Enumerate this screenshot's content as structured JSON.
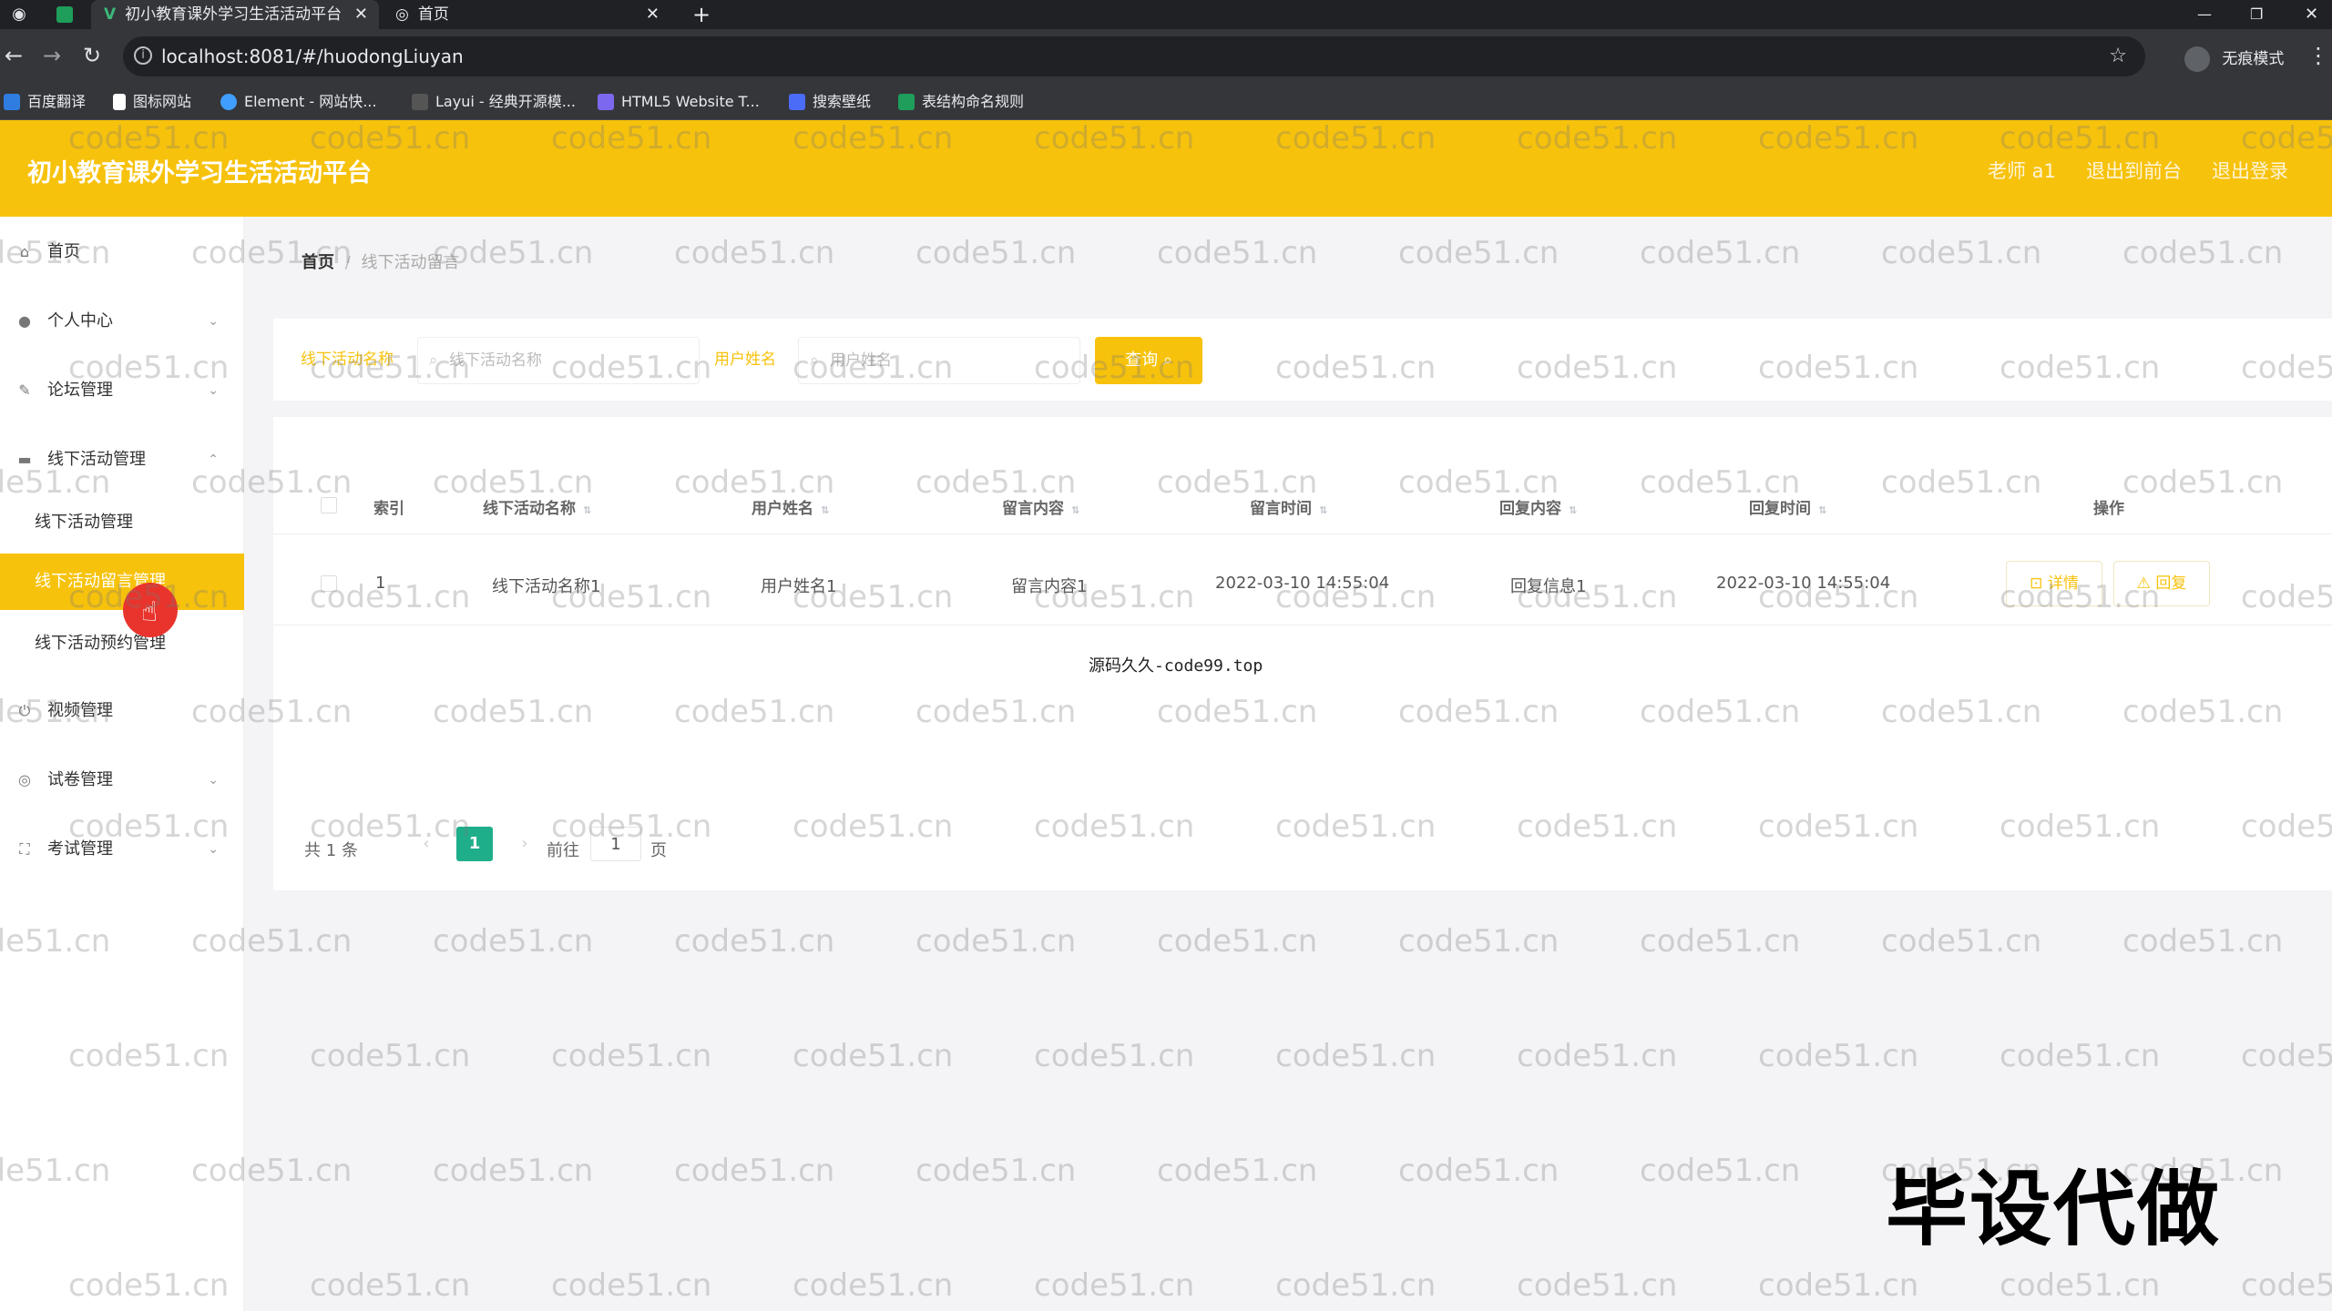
{
  "browser": {
    "tabs": [
      {
        "title": "初小教育课外学习生活活动平台",
        "active": true
      },
      {
        "title": "首页",
        "active": false
      }
    ],
    "new_tab": "+",
    "url": "localhost:8081/#/huodongLiuyan",
    "profile_label": "无痕模式",
    "bookmarks": [
      "百度翻译",
      "图标网站",
      "Element - 网站快...",
      "Layui - 经典开源模...",
      "HTML5 Website T...",
      "搜索壁纸",
      "表结构命名规则"
    ]
  },
  "header": {
    "title": "初小教育课外学习生活活动平台",
    "user": "老师 a1",
    "back_front": "退出到前台",
    "logout": "退出登录"
  },
  "sidebar": {
    "items": [
      {
        "label": "首页",
        "icon": "home-icon"
      },
      {
        "label": "个人中心",
        "icon": "user-icon"
      },
      {
        "label": "论坛管理",
        "icon": "edit-icon"
      },
      {
        "label": "线下活动管理",
        "icon": "monitor-icon"
      },
      {
        "label": "视频管理",
        "icon": "power-icon"
      },
      {
        "label": "试卷管理",
        "icon": "compass-icon"
      },
      {
        "label": "考试管理",
        "icon": "frame-icon"
      }
    ],
    "sub_items": [
      "线下活动管理",
      "线下活动留言管理",
      "线下活动预约管理"
    ]
  },
  "breadcrumb": {
    "home": "首页",
    "sep": "/",
    "current": "线下活动留言"
  },
  "search": {
    "label1": "线下活动名称",
    "placeholder1": "线下活动名称",
    "label2": "用户姓名",
    "placeholder2": "用户姓名",
    "button": "查询"
  },
  "table": {
    "columns": [
      "索引",
      "线下活动名称",
      "用户姓名",
      "留言内容",
      "留言时间",
      "回复内容",
      "回复时间",
      "操作"
    ],
    "rows": [
      {
        "index": "1",
        "name": "线下活动名称1",
        "user": "用户姓名1",
        "content": "留言内容1",
        "time": "2022-03-10 14:55:04",
        "reply": "回复信息1",
        "reply_time": "2022-03-10 14:55:04"
      }
    ],
    "actions": [
      "详情",
      "回复"
    ]
  },
  "pagination": {
    "total": "共 1 条",
    "current": "1",
    "goto": "前往",
    "goto_value": "1",
    "page_unit": "页"
  },
  "watermark": {
    "text": "code51.cn",
    "footer": "源码久久-code99.top",
    "big": "毕设代做"
  }
}
